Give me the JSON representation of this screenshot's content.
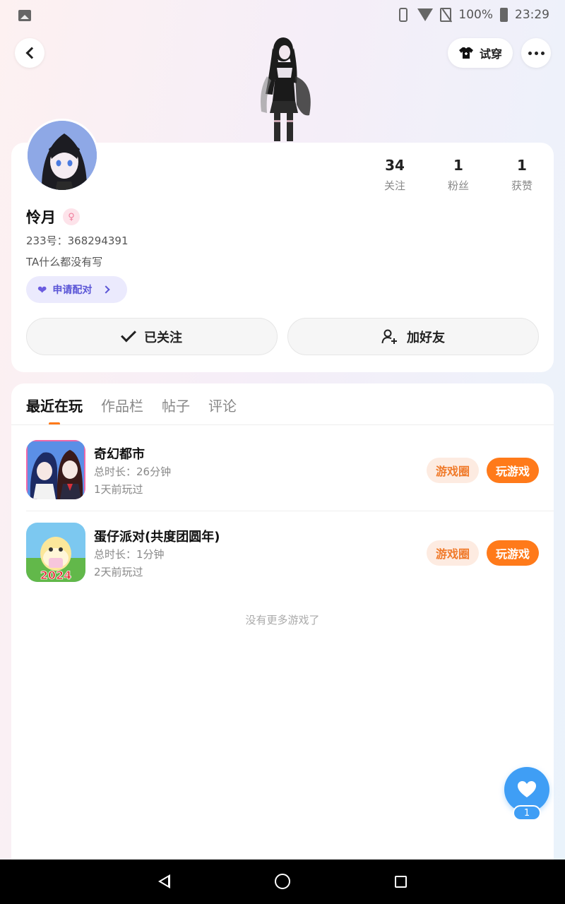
{
  "status_bar": {
    "battery": "100%",
    "time": "23:29"
  },
  "header": {
    "try_on_label": "试穿"
  },
  "profile": {
    "name": "怜月",
    "uid_text": "233号：368294391",
    "bio": "TA什么都没有写",
    "match_label": "申请配对",
    "stats": [
      {
        "value": "34",
        "label": "关注"
      },
      {
        "value": "1",
        "label": "粉丝"
      },
      {
        "value": "1",
        "label": "获赞"
      }
    ],
    "follow_label": "已关注",
    "add_friend_label": "加好友"
  },
  "tabs": [
    {
      "label": "最近在玩",
      "active": true
    },
    {
      "label": "作品栏",
      "active": false
    },
    {
      "label": "帖子",
      "active": false
    },
    {
      "label": "评论",
      "active": false
    }
  ],
  "games": [
    {
      "title": "奇幻都市",
      "duration": "总时长：26分钟",
      "last_played": "1天前玩过",
      "circle_label": "游戏圈",
      "play_label": "玩游戏"
    },
    {
      "title": "蛋仔派对(共度团圆年)",
      "duration": "总时长：1分钟",
      "last_played": "2天前玩过",
      "circle_label": "游戏圈",
      "play_label": "玩游戏",
      "icon_badge": "2024"
    }
  ],
  "no_more_text": "没有更多游戏了",
  "like_count": "1",
  "colors": {
    "accent": "#ff7a1a",
    "like_blue": "#3f9ef5",
    "match_purple": "#5a55d6"
  }
}
